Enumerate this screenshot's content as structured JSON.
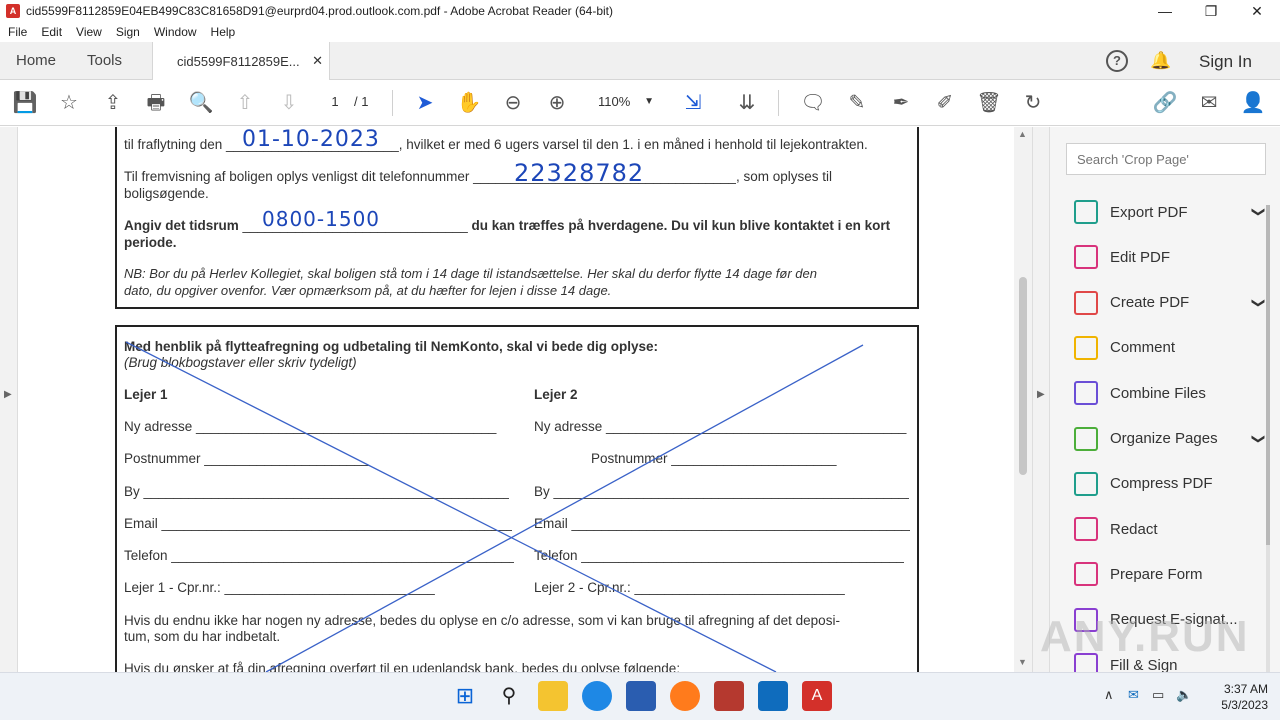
{
  "window": {
    "title": "cid5599F8112859E04EB499C83C81658D91@eurprd04.prod.outlook.com.pdf - Adobe Acrobat Reader (64-bit)",
    "app_icon_glyph": "A",
    "controls": {
      "minimize": "—",
      "maximize": "❐",
      "close": "✕"
    }
  },
  "menu": [
    "File",
    "Edit",
    "View",
    "Sign",
    "Window",
    "Help"
  ],
  "tabs": {
    "home": "Home",
    "tools": "Tools",
    "document": "cid5599F8112859E...",
    "close": "✕"
  },
  "header_right": {
    "help_icon": "?",
    "bell_icon": "🔔",
    "sign_in": "Sign In"
  },
  "toolbar": {
    "page_current": "1",
    "page_total": "/ 1",
    "zoom": "110%",
    "zoom_caret": "▼",
    "icons": {
      "save": "💾",
      "bookmark": "☆",
      "upload": "⇪",
      "print": "🖶",
      "find": "🔍",
      "prev": "⇧",
      "next": "⇩",
      "select": "➤",
      "hand": "✋",
      "zoom_out": "⊖",
      "zoom_in": "⊕",
      "fit": "⇲",
      "scroll": "⇊",
      "comment": "🗨",
      "highlight": "✎",
      "sign": "✒",
      "edit": "✐",
      "delete": "🗑",
      "rotate": "↻",
      "link": "🔗",
      "mail": "✉",
      "share": "👤"
    }
  },
  "document": {
    "line1": "til fraflytning den _______________________, hvilket er med 6 ugers varsel til den 1. i en måned i henhold til lejekontrakten.",
    "hand_date": "01-10-2023",
    "line2a": "Til fremvisning af boligen oplys venligst dit telefonnummer ___________________________________, som oplyses til",
    "line2b": "boligsøgende.",
    "hand_phone": "22328782",
    "line3a_label": "Angiv det tidsrum",
    "line3a_blank": "______________________________",
    "line3a_rest": "du kan træffes på hverdagene. Du vil kun blive kontaktet i en kort",
    "line3b": "periode.",
    "hand_time": "0800-1500",
    "note1": "NB: Bor du på Herlev Kollegiet, skal boligen stå tom i 14 dage til istandsættelse. Her skal du derfor flytte 14 dage før den",
    "note2": "dato, du opgiver ovenfor. Vær opmærksom på, at du hæfter for lejen i disse 14 dage.",
    "sec2_title": "Med henblik på flytteafregning og udbetaling til NemKonto, skal vi bede dig oplyse:",
    "sec2_sub": "(Brug blokbogstaver eller skriv tydeligt)",
    "lejer1": "Lejer 1",
    "lejer2": "Lejer 2",
    "ny_adresse1": "Ny adresse ________________________________________",
    "ny_adresse2": "Ny adresse ________________________________________",
    "postnr1": "Postnummer ______________________",
    "postnr2": "Postnummer ______________________",
    "by1": "By _____________________________________________________",
    "by2": "By _____________________________________________________",
    "email1": "Email ___________________________________________________",
    "email2": "Email ___________________________________________________",
    "tlf1": "Telefon ________________________________________________",
    "tlf2": "Telefon ________________________________________________",
    "cpr1": "Lejer 1 - Cpr.nr.:   ____________________________",
    "cpr2": "Lejer 2 - Cpr.nr.:   ____________________________",
    "para1a": "Hvis du endnu ikke har nogen ny adresse, bedes du oplyse en c/o adresse, som vi kan bruge til afregning af det deposi-",
    "para1b": "tum, som du har indbetalt.",
    "para2": "Hvis du ønsker at få din afregning overført til en udenlandsk bank, bedes du oplyse følgende:"
  },
  "right_pane": {
    "search_placeholder": "Search 'Crop Page'",
    "tools": [
      {
        "label": "Export PDF",
        "chevron": "❯",
        "color": "#1f9e8c"
      },
      {
        "label": "Edit PDF",
        "chevron": "",
        "color": "#d8337c"
      },
      {
        "label": "Create PDF",
        "chevron": "❯",
        "color": "#e04848"
      },
      {
        "label": "Comment",
        "chevron": "",
        "color": "#f0b400"
      },
      {
        "label": "Combine Files",
        "chevron": "",
        "color": "#6a4ed6"
      },
      {
        "label": "Organize Pages",
        "chevron": "❯",
        "color": "#4cae3a"
      },
      {
        "label": "Compress PDF",
        "chevron": "",
        "color": "#1f9e8c"
      },
      {
        "label": "Redact",
        "chevron": "",
        "color": "#d8337c"
      },
      {
        "label": "Prepare Form",
        "chevron": "",
        "color": "#d8337c"
      },
      {
        "label": "Request E-signat...",
        "chevron": "",
        "color": "#8a3fd1"
      },
      {
        "label": "Fill & Sign",
        "chevron": "",
        "color": "#8a3fd1"
      }
    ]
  },
  "taskbar": {
    "time": "3:37 AM",
    "date": "5/3/2023",
    "tray_chevron": "∧",
    "watermark": "ANY.RUN"
  }
}
